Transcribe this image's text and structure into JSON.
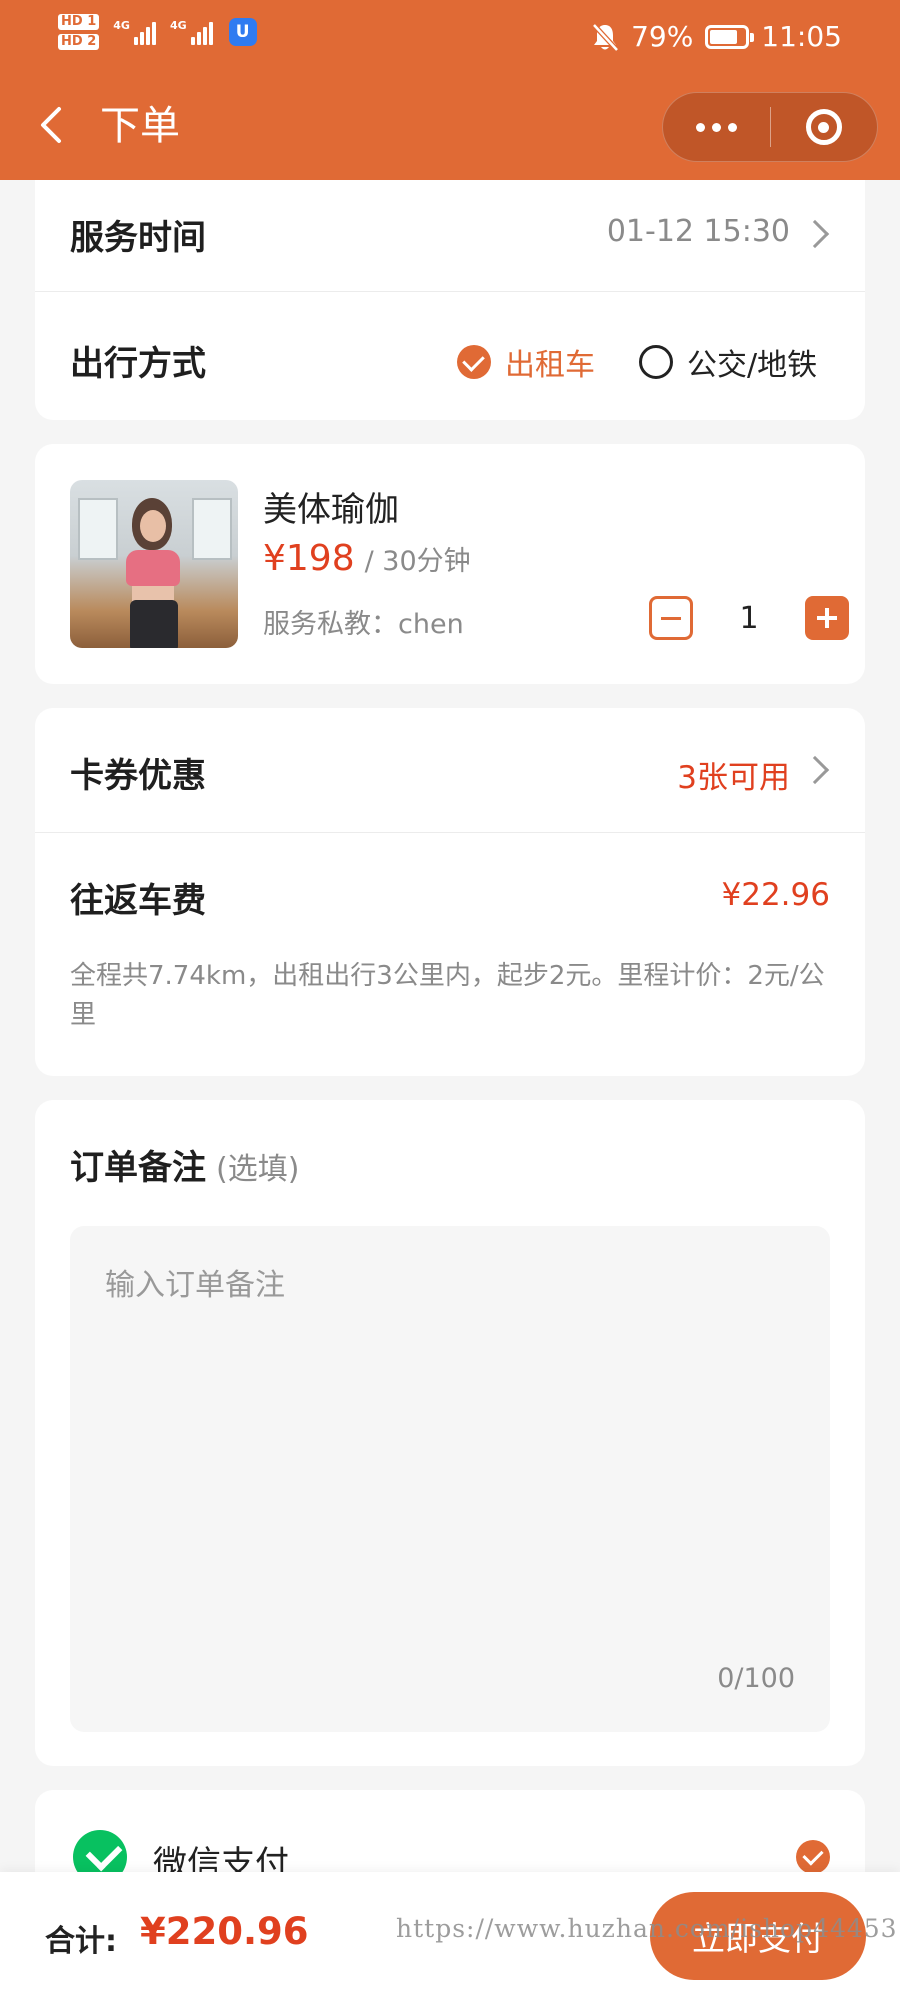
{
  "theme": {
    "accent": "#e06a35",
    "price_red": "#e0401f",
    "page_bg": "#f5f5f5",
    "wechat_green": "#08c160"
  },
  "status_bar": {
    "sim_badges": [
      "HD 1",
      "HD 2"
    ],
    "network_labels": [
      "4G",
      "4G"
    ],
    "app_badge": "U",
    "battery_percent": "79%",
    "battery_level": 0.79,
    "time": "11:05",
    "icons": [
      "mute-bell-icon",
      "battery-icon"
    ]
  },
  "nav": {
    "back_icon": "chevron-left-icon",
    "title": "下单",
    "capsule_icons": [
      "more-dots-icon",
      "target-icon"
    ]
  },
  "service_time": {
    "label": "服务时间",
    "value": "01-12 15:30"
  },
  "travel": {
    "label": "出行方式",
    "options": [
      {
        "label": "出租车",
        "selected": true
      },
      {
        "label": "公交/地铁",
        "selected": false
      }
    ]
  },
  "product": {
    "name": "美体瑜伽",
    "price": "¥198",
    "unit": "/ 30分钟",
    "trainer": "服务私教：chen",
    "quantity": "1",
    "image_icon": "yoga-photo"
  },
  "coupon": {
    "label": "卡券优惠",
    "value": "3张可用"
  },
  "fare": {
    "label": "往返车费",
    "value": "¥22.96",
    "note": "全程共7.74km，出租出行3公里内，起步2元。里程计价：2元/公里"
  },
  "remark": {
    "title": "订单备注",
    "optional": "(选填)",
    "placeholder": "输入订单备注",
    "value": "",
    "count": "0/100"
  },
  "payment": {
    "method": "微信支付",
    "icon": "wechat-pay-icon",
    "selected": true
  },
  "footer": {
    "total_label": "合计:",
    "total_value": "¥220.96",
    "pay_button": "立即支付",
    "watermark": "https://www.huzhan.com/ishop44453"
  }
}
